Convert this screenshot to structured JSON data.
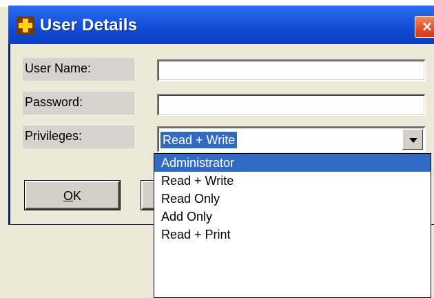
{
  "window": {
    "title": "User Details",
    "close_glyph": "×",
    "icon": "plus-icon"
  },
  "form": {
    "username_label": "User Name:",
    "username_value": "",
    "password_label": "Password:",
    "password_value": "",
    "privileges_label": "Privileges:",
    "privileges_value": "Read + Write"
  },
  "buttons": {
    "ok_mnemonic": "O",
    "ok_rest": "K",
    "cancel_label": ""
  },
  "dropdown": {
    "options": [
      "Administrator",
      "Read + Write",
      "Read Only",
      "Add Only",
      "Read + Print"
    ],
    "highlighted": "Administrator"
  },
  "colors": {
    "title_bar": "#1a57dd",
    "selection": "#316ac5",
    "close_button": "#e2552c",
    "dialog_bg": "#ece9d8"
  }
}
